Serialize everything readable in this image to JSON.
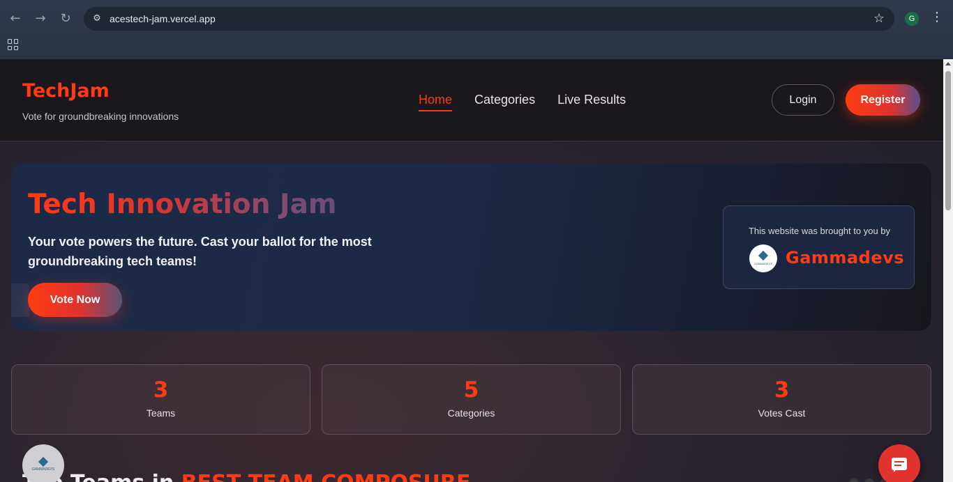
{
  "browser": {
    "url": "acestech-jam.vercel.app",
    "profile_initial": "G",
    "back_icon": "←",
    "forward_icon": "→",
    "reload_icon": "↻",
    "site_info_icon": "⚙",
    "star_icon": "☆",
    "menu_icon": "⋮"
  },
  "header": {
    "brand": "TechJam",
    "tagline": "Vote for groundbreaking innovations",
    "nav": [
      {
        "label": "Home",
        "active": true
      },
      {
        "label": "Categories",
        "active": false
      },
      {
        "label": "Live Results",
        "active": false
      }
    ],
    "login_label": "Login",
    "register_label": "Register"
  },
  "hero": {
    "title": "Tech Innovation Jam",
    "subtitle": "Your vote powers the future. Cast your ballot for the most groundbreaking tech teams!",
    "cta_label": "Vote Now",
    "credit": {
      "text": "This website was brought to you by",
      "name": "Gammadevs",
      "logo_text": "GAMMADEVS"
    }
  },
  "stats": [
    {
      "value": "3",
      "label": "Teams"
    },
    {
      "value": "5",
      "label": "Categories"
    },
    {
      "value": "3",
      "label": "Votes Cast"
    }
  ],
  "section": {
    "title_prefix": "Top Teams in",
    "title_accent": "BEST TEAM COMPOSURE"
  },
  "floating": {
    "logo_text": "GAMMADEVS"
  },
  "colors": {
    "accent": "#ff3b14",
    "background": "#1b1a22",
    "hero_bg": "#1c2a48"
  }
}
